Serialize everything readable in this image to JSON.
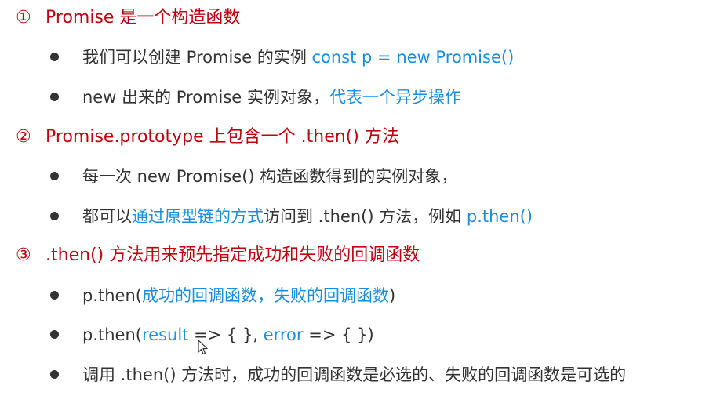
{
  "colors": {
    "heading": "#c0000e",
    "text": "#333333",
    "highlight": "#1a8ee0"
  },
  "sections": [
    {
      "number": "①",
      "title": "Promise 是一个构造函数",
      "bullets": [
        {
          "text": "我们可以创建 Promise 的实例 ",
          "highlight": "const p = new Promise()"
        },
        {
          "text": "new 出来的 Promise 实例对象，",
          "highlight": "代表一个异步操作"
        }
      ]
    },
    {
      "number": "②",
      "title": "Promise.prototype 上包含一个 .then() 方法",
      "bullets": [
        {
          "text": "每一次 new Promise() 构造函数得到的实例对象，"
        },
        {
          "pre": "都可以",
          "highlight": "通过原型链的方式",
          "post": "访问到 .then() 方法，例如 ",
          "highlight2": "p.then()"
        }
      ]
    },
    {
      "number": "③",
      "title": ".then() 方法用来预先指定成功和失败的回调函数",
      "bullets": [
        {
          "pre": "p.then(",
          "highlight": "成功的回调函数",
          "mid": "，",
          "highlight2": "失败的回调函数",
          "post": ")"
        },
        {
          "pre": "p.then(",
          "highlight": "result",
          "mid": " => { }, ",
          "highlight2": "error",
          "post": " => { })"
        },
        {
          "text": "调用 .then() 方法时，成功的回调函数是必选的、失败的回调函数是可选的"
        }
      ]
    }
  ]
}
